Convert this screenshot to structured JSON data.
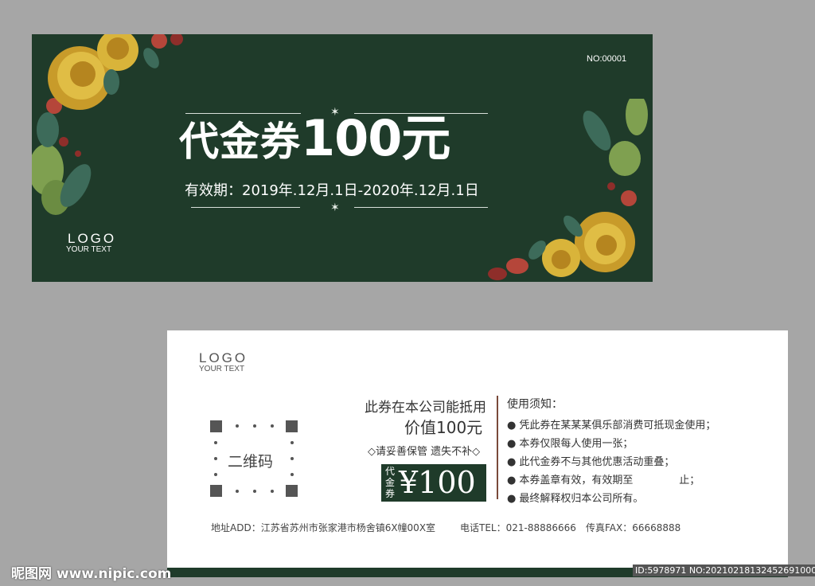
{
  "front": {
    "serial": "NO:00001",
    "title_main": "代金券",
    "title_amount": "100元",
    "validity": "有效期：2019年.12月.1日-2020年.12月.1日",
    "logo": "LOGO",
    "logo_sub": "YOUR TEXT"
  },
  "back": {
    "logo": "LOGO",
    "logo_sub": "YOUR TEXT",
    "qr_label": "二维码",
    "use_line1": "此券在本公司能抵用",
    "use_line2": "价值100元",
    "keep_note": "◇请妥善保管 遗失不补◇",
    "price_tag_vertical": "代金券",
    "price_amount": "¥100",
    "notes_title": "使用须知：",
    "notes": [
      "凭此券在某某某俱乐部消费可抵现金使用；",
      "本券仅限每人使用一张；",
      "此代金券不与其他优惠活动重叠；",
      "本券盖章有效，有效期至              止；",
      "最终解释权归本公司所有。"
    ],
    "address": "地址ADD：江苏省苏州市张家港市杨舍镇6X幢00X室",
    "tel": "电话TEL：021-88886666",
    "fax": "传真FAX：66668888"
  },
  "watermark": {
    "site": "昵图网 www.nipic.com",
    "id": "ID:5978971 NO:20210218132452691000"
  },
  "colors": {
    "dark_green": "#1f3b2a",
    "gold": "#d9b43a",
    "red_flower": "#b5463a",
    "leaf": "#7fa050",
    "background": "#a6a6a6"
  }
}
